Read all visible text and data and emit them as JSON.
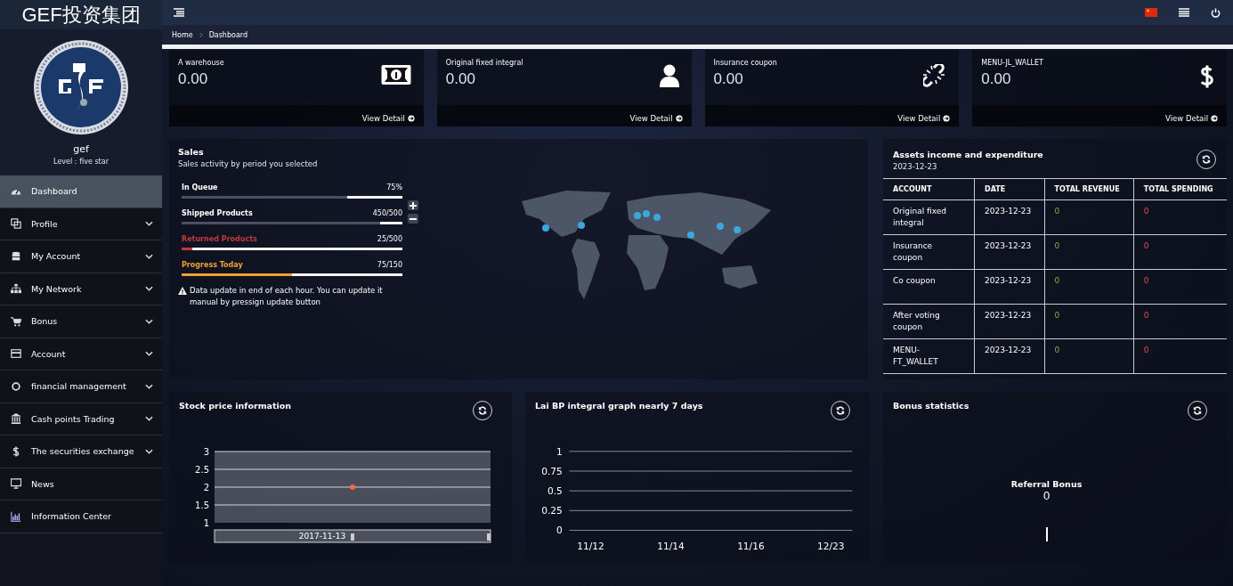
{
  "brand": {
    "title": "GEF投资集团"
  },
  "user": {
    "name": "gef",
    "level": "Level：five star"
  },
  "sidebar": {
    "items": [
      {
        "label": "Dashboard",
        "submenu": false,
        "selected": true
      },
      {
        "label": "Profile",
        "submenu": true,
        "selected": false
      },
      {
        "label": "My Account",
        "submenu": true,
        "selected": false
      },
      {
        "label": "My Network",
        "submenu": true,
        "selected": false
      },
      {
        "label": "Bonus",
        "submenu": true,
        "selected": false
      },
      {
        "label": "Account",
        "submenu": true,
        "selected": false
      },
      {
        "label": "financial management",
        "submenu": true,
        "selected": false
      },
      {
        "label": "Cash points Trading",
        "submenu": true,
        "selected": false
      },
      {
        "label": "The securities exchange",
        "submenu": true,
        "selected": false
      },
      {
        "label": "News",
        "submenu": false,
        "selected": false
      },
      {
        "label": "Information Center",
        "submenu": false,
        "selected": false
      }
    ]
  },
  "breadcrumb": [
    "Home",
    "Dashboard"
  ],
  "stats": [
    {
      "label": "A warehouse",
      "value": "0.00",
      "link": "View Detail"
    },
    {
      "label": "Original fixed integral",
      "value": "0.00",
      "link": "View Detail"
    },
    {
      "label": "Insurance coupon",
      "value": "0.00",
      "link": "View Detail"
    },
    {
      "label": "MENU-JL_WALLET",
      "value": "0.00",
      "link": "View Detail"
    }
  ],
  "sales": {
    "title": "Sales",
    "subtitle": "Sales activity by period you selected",
    "bars": [
      {
        "label": "In Queue",
        "reading": "75%",
        "level": 0.75,
        "color": "#4a5060"
      },
      {
        "label": "Shipped Products",
        "reading": "450/500",
        "level": 0.9,
        "color": "#4a5060"
      },
      {
        "label": "Returned Products",
        "reading": "25/500",
        "level": 0.05,
        "color": "#c0393b"
      },
      {
        "label": "Progress Today",
        "reading": "75/150",
        "level": 0.5,
        "color": "#f0a030"
      }
    ],
    "note": "Data update in end of each hour. You can update it manual by pressign update button"
  },
  "assets": {
    "title": "Assets income and expenditure",
    "date": "2023-12-23",
    "columns": [
      "ACCOUNT",
      "DATE",
      "TOTAL REVENUE",
      "TOTAL SPENDING"
    ],
    "rows": [
      [
        "Original fixed integral",
        "2023-12-23",
        "0",
        "0"
      ],
      [
        "Insurance coupon",
        "2023-12-23",
        "0",
        "0"
      ],
      [
        "Co coupon",
        "2023-12-23",
        "0",
        "0"
      ],
      [
        "After voting coupon",
        "2023-12-23",
        "0",
        "0"
      ],
      [
        "MENU-FT_WALLET",
        "2023-12-23",
        "0",
        "0"
      ]
    ]
  },
  "stock": {
    "title": "Stock price information",
    "chart_data": {
      "type": "scatter",
      "categories": [
        "2017-11-13"
      ],
      "series": [
        {
          "color": "#ff6a3d",
          "values": [
            2
          ]
        }
      ],
      "ylim": [
        1,
        3
      ],
      "yticks": [
        1,
        1.5,
        2,
        2.5,
        3
      ],
      "grid": true
    }
  },
  "integral": {
    "title": "Lai BP integral graph nearly 7 days",
    "chart_data": {
      "type": "line",
      "categories": [
        "11/12",
        "11/14",
        "11/16",
        "12/23"
      ],
      "ylim": [
        0,
        1
      ],
      "yticks": [
        0,
        0.25,
        0.5,
        0.75,
        1
      ],
      "grid": true
    }
  },
  "bonus": {
    "title": "Bonus statistics",
    "label": "Referral Bonus",
    "value": "0"
  }
}
